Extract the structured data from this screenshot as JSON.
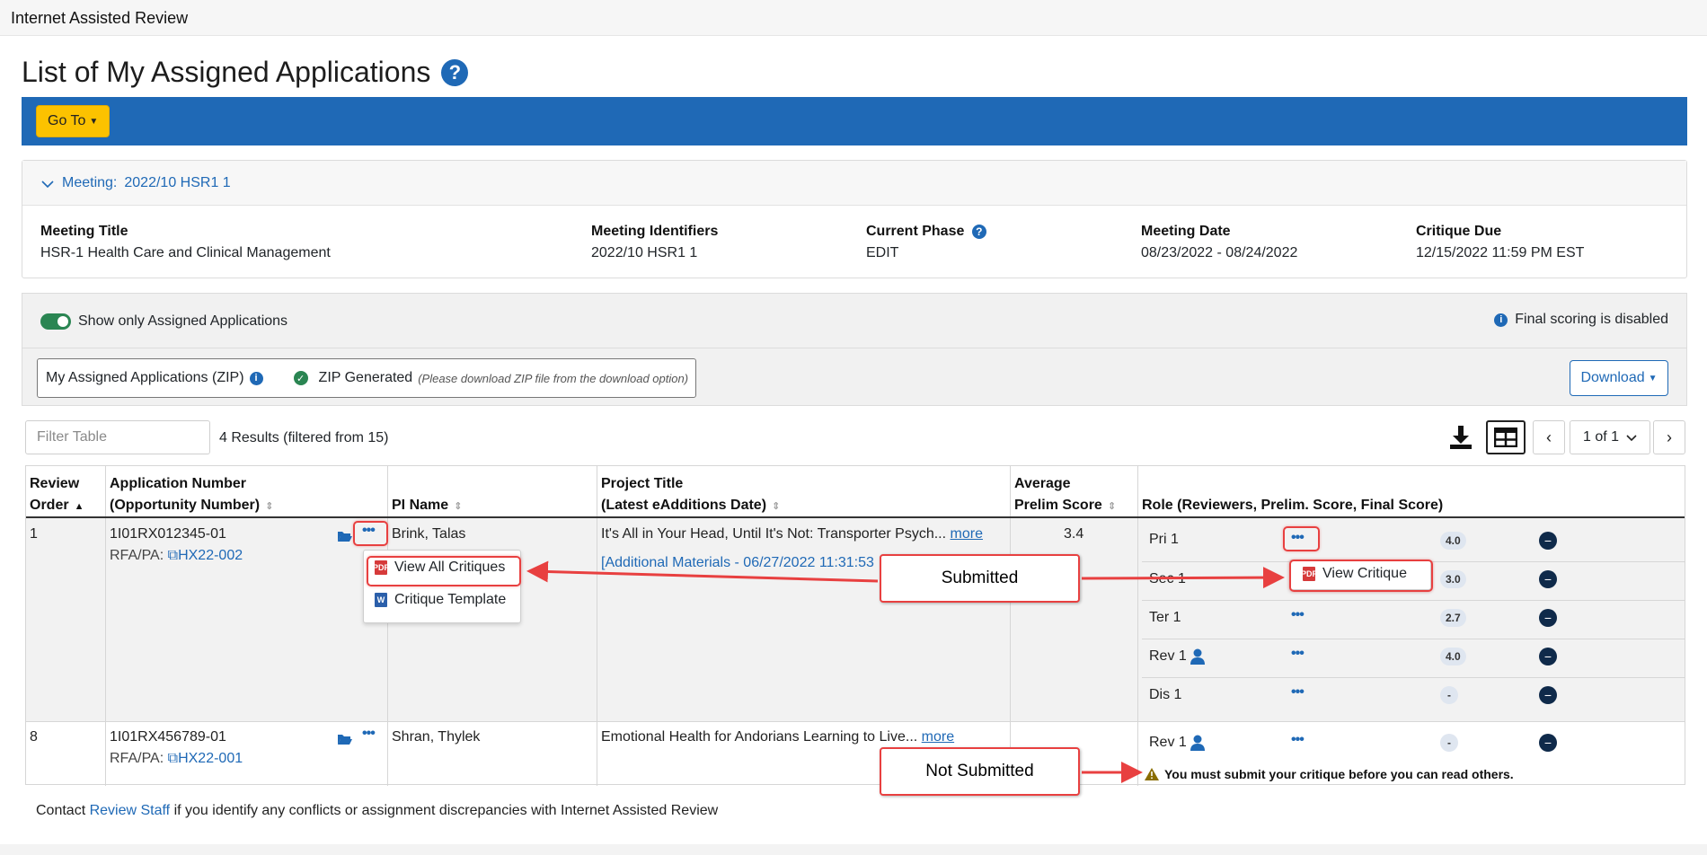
{
  "app": {
    "title": "Internet Assisted Review"
  },
  "page": {
    "title": "List of My Assigned Applications",
    "help_icon": "question-circle-icon"
  },
  "toolbar": {
    "goto_label": "Go To"
  },
  "meeting": {
    "toggle_label": "Meeting:",
    "toggle_value": "2022/10 HSR1 1",
    "fields": [
      {
        "label": "Meeting Title",
        "value": "HSR-1 Health Care and Clinical Management"
      },
      {
        "label": "Meeting Identifiers",
        "value": "2022/10 HSR1 1"
      },
      {
        "label": "Current Phase",
        "value": "EDIT"
      },
      {
        "label": "Meeting Date",
        "value": "08/23/2022 - 08/24/2022"
      },
      {
        "label": "Critique Due",
        "value": "12/15/2022 11:59 PM EST"
      }
    ]
  },
  "filters": {
    "show_assigned_label": "Show only Assigned Applications",
    "final_scoring_text": "Final scoring is disabled",
    "zip_label": "My Assigned Applications (ZIP)",
    "zip_status": "ZIP Generated",
    "zip_note": "(Please download ZIP file from the download option)",
    "download_label": "Download"
  },
  "table_controls": {
    "filter_placeholder": "Filter Table",
    "results_text": "4 Results (filtered from 15)",
    "page_label": "1 of 1"
  },
  "table": {
    "headers": {
      "review_order": [
        "Review",
        "Order"
      ],
      "application_number": [
        "Application Number",
        "(Opportunity Number)"
      ],
      "pi_name": "PI Name",
      "project_title": [
        "Project Title",
        "(Latest eAdditions Date)"
      ],
      "avg_prelim": [
        "Average",
        "Prelim Score"
      ],
      "role": "Role (Reviewers, Prelim. Score, Final Score)"
    },
    "rows": [
      {
        "order": "1",
        "app_number": "1I01RX012345-01",
        "rfa_prefix": "RFA/PA:",
        "rfa": "HX22-002",
        "pi": "Brink, Talas",
        "title": "It's All in Your Head, Until It's Not: Transporter Psych...",
        "more": "more",
        "additional": "[Additional Materials - 06/27/2022 11:31:53",
        "avg": "3.4",
        "roles": [
          {
            "name": "Pri 1",
            "score": "4.0"
          },
          {
            "name": "Sec 1",
            "score": "3.0"
          },
          {
            "name": "Ter 1",
            "score": "2.7"
          },
          {
            "name": "Rev 1",
            "score": "4.0"
          },
          {
            "name": "Dis 1",
            "score": "-"
          }
        ]
      },
      {
        "order": "8",
        "app_number": "1I01RX456789-01",
        "rfa_prefix": "RFA/PA:",
        "rfa": "HX22-001",
        "pi": "Shran, Thylek",
        "title": "Emotional Health for Andorians Learning to Live...",
        "more": "more",
        "avg": "",
        "roles": [
          {
            "name": "Rev 1",
            "score": "-"
          }
        ],
        "warning": "You must submit your critique before you can read others."
      }
    ]
  },
  "menus": {
    "app_actions": [
      "View All Critiques",
      "Critique Template"
    ],
    "role_actions": [
      "View Critique"
    ]
  },
  "callouts": {
    "submitted": "Submitted",
    "not_submitted": "Not Submitted"
  },
  "footer": {
    "prefix": "Contact",
    "link": "Review Staff",
    "suffix": "if you identify any conflicts or assignment discrepancies with Internet Assisted Review"
  },
  "colors": {
    "brand_blue": "#1f69b6",
    "goto_yellow": "#fcc200",
    "toggle_green": "#2a8552",
    "callout_red": "#e84040"
  }
}
